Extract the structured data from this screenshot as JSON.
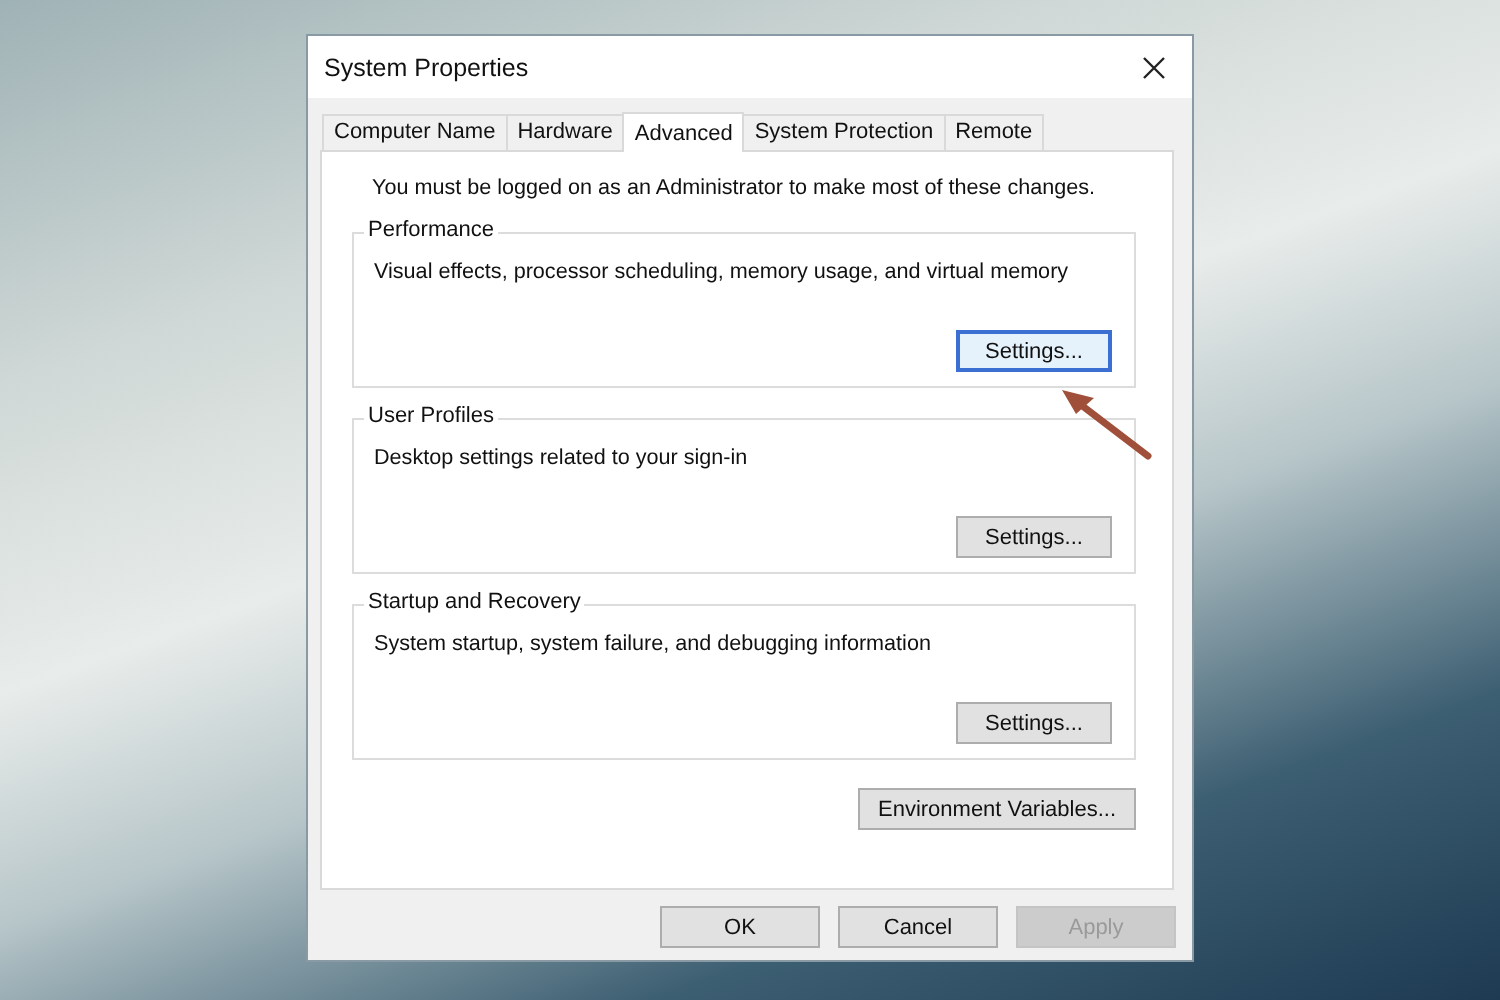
{
  "window": {
    "title": "System Properties"
  },
  "tabs": [
    {
      "label": "Computer Name",
      "selected": false
    },
    {
      "label": "Hardware",
      "selected": false
    },
    {
      "label": "Advanced",
      "selected": true
    },
    {
      "label": "System Protection",
      "selected": false
    },
    {
      "label": "Remote",
      "selected": false
    }
  ],
  "admin_note": "You must be logged on as an Administrator to make most of these changes.",
  "groups": [
    {
      "title": "Performance",
      "description": "Visual effects, processor scheduling, memory usage, and virtual memory",
      "button": {
        "label": "Settings...",
        "focused": true
      }
    },
    {
      "title": "User Profiles",
      "description": "Desktop settings related to your sign-in",
      "button": {
        "label": "Settings...",
        "focused": false
      }
    },
    {
      "title": "Startup and Recovery",
      "description": "System startup, system failure, and debugging information",
      "button": {
        "label": "Settings...",
        "focused": false
      }
    }
  ],
  "environment_button": {
    "label": "Environment Variables..."
  },
  "dialog_buttons": [
    {
      "label": "OK",
      "disabled": false
    },
    {
      "label": "Cancel",
      "disabled": false
    },
    {
      "label": "Apply",
      "disabled": true
    }
  ]
}
